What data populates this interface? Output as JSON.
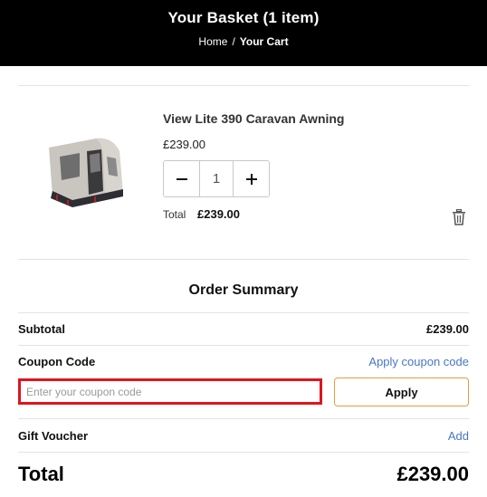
{
  "header": {
    "title": "Your Basket (1 item)",
    "breadcrumb": {
      "home": "Home",
      "separator": "/",
      "current": "Your Cart"
    }
  },
  "item": {
    "name": "View Lite 390 Caravan Awning",
    "price": "£239.00",
    "quantity": "1",
    "total_label": "Total",
    "total_value": "£239.00"
  },
  "summary": {
    "title": "Order Summary",
    "subtotal_label": "Subtotal",
    "subtotal_value": "£239.00",
    "coupon_label": "Coupon Code",
    "coupon_link": "Apply coupon code",
    "coupon_placeholder": "Enter your coupon code",
    "coupon_value": "",
    "apply_label": "Apply",
    "gift_label": "Gift Voucher",
    "gift_link": "Add",
    "total_label": "Total",
    "total_value": "£239.00"
  },
  "colors": {
    "header_bg": "#000000",
    "link": "#4a74c9",
    "highlight_border": "#e0141e",
    "apply_border": "#e0a040"
  }
}
